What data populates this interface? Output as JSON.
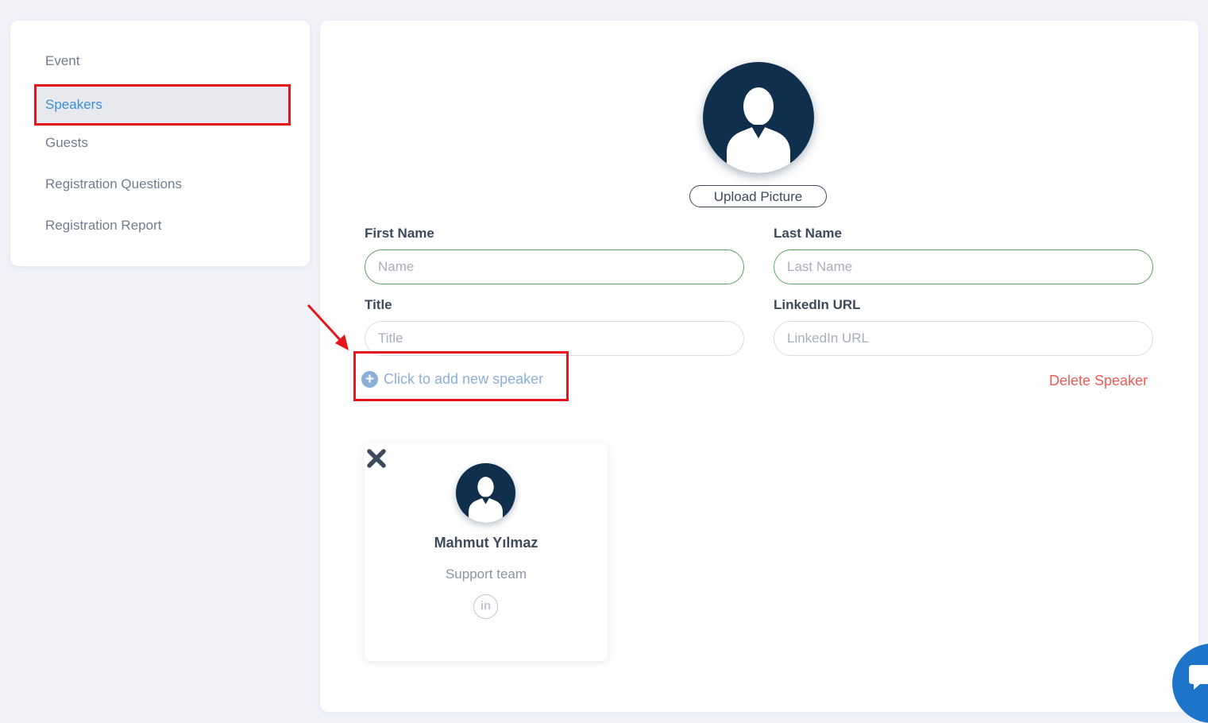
{
  "sidebar": {
    "items": [
      {
        "label": "Event"
      },
      {
        "label": "Speakers"
      },
      {
        "label": "Guests"
      },
      {
        "label": "Registration Questions"
      },
      {
        "label": "Registration Report"
      }
    ],
    "active_index": 1
  },
  "speaker_form": {
    "upload_label": "Upload Picture",
    "first_name": {
      "label": "First Name",
      "placeholder": "Name",
      "value": ""
    },
    "last_name": {
      "label": "Last Name",
      "placeholder": "Last Name",
      "value": ""
    },
    "title": {
      "label": "Title",
      "placeholder": "Title",
      "value": ""
    },
    "linkedin": {
      "label": "LinkedIn URL",
      "placeholder": "LinkedIn URL",
      "value": ""
    },
    "add_speaker_label": "Click to add new speaker",
    "delete_speaker_label": "Delete Speaker"
  },
  "speakers": [
    {
      "name": "Mahmut Yılmaz",
      "role": "Support team",
      "linkedin_icon": "in"
    }
  ],
  "icons": {
    "plus": "+",
    "remove": "x-icon",
    "avatar": "user-silhouette-icon",
    "chat": "chat-bubble-icon"
  },
  "colors": {
    "accent": "#3b8fd6",
    "annotation": "#e8141b",
    "delete": "#ef5b54",
    "avatar_bg": "#0f2f4c",
    "chat_button": "#1e74c9"
  }
}
